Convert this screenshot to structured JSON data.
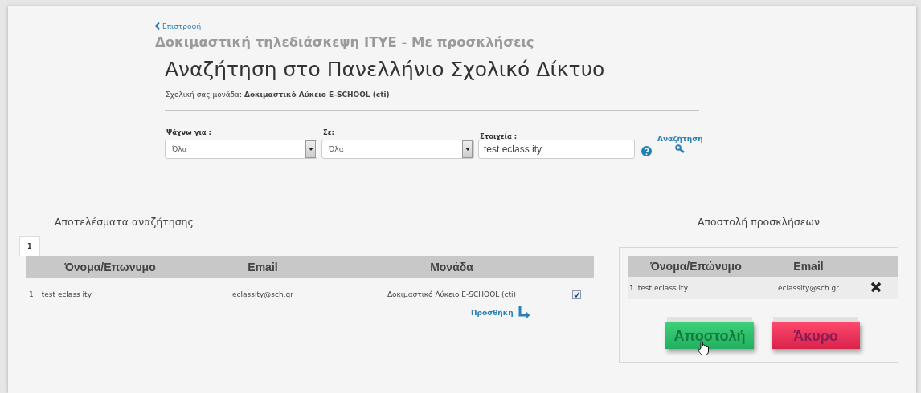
{
  "back_link": "Επιστροφή",
  "conference_title": "Δοκιμαστική τηλεδιάσκεψη ΙΤΥΕ - Με προσκλήσεις",
  "page_title": "Αναζήτηση στο Πανελλήνιο Σχολικό Δίκτυο",
  "school_unit": {
    "label": "Σχολική σας μονάδα:",
    "value": "Δοκιμαστικό Λύκειο E-SCHOOL (cti)"
  },
  "search": {
    "fields": [
      {
        "kind": "select",
        "label": "Ψάχνω για :",
        "value": "Όλα"
      },
      {
        "kind": "select",
        "label": "Σε:",
        "value": "Όλα"
      },
      {
        "kind": "text",
        "label": "Στοιχεία :",
        "value": "test eclass ity"
      }
    ],
    "search_button": "Αναζήτηση"
  },
  "results": {
    "title": "Αποτελέσματα αναζήτησης",
    "pages": [
      {
        "label": "1",
        "selected": true
      }
    ],
    "columns": [
      "Όνομα/Επωνυμο",
      "Email",
      "Μονάδα"
    ],
    "rows": [
      {
        "index": "1",
        "name": "test eclass ity",
        "email": "eclassity@sch.gr",
        "unit": "Δοκιμαστικό Λύκειο E-SCHOOL (cti)",
        "checked": true
      }
    ],
    "add_button": "Προσθήκη"
  },
  "invitations": {
    "title": "Αποστολή προσκλήσεων",
    "columns": [
      "Όνομα/Επώνυμο",
      "Email"
    ],
    "rows": [
      {
        "index": "1",
        "name": "test eclass ity",
        "email": "eclassity@sch.gr"
      }
    ],
    "buttons": [
      {
        "kind": "send",
        "label": "Αποστολή"
      },
      {
        "kind": "cancel",
        "label": "Άκυρο"
      }
    ]
  }
}
